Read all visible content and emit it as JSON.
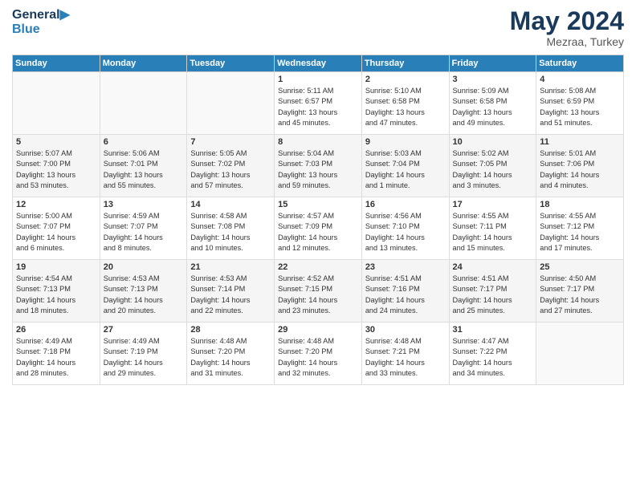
{
  "logo": {
    "line1": "General",
    "line2": "Blue"
  },
  "title": "May 2024",
  "location": "Mezraa, Turkey",
  "weekdays": [
    "Sunday",
    "Monday",
    "Tuesday",
    "Wednesday",
    "Thursday",
    "Friday",
    "Saturday"
  ],
  "weeks": [
    [
      {
        "day": "",
        "info": ""
      },
      {
        "day": "",
        "info": ""
      },
      {
        "day": "",
        "info": ""
      },
      {
        "day": "1",
        "info": "Sunrise: 5:11 AM\nSunset: 6:57 PM\nDaylight: 13 hours\nand 45 minutes."
      },
      {
        "day": "2",
        "info": "Sunrise: 5:10 AM\nSunset: 6:58 PM\nDaylight: 13 hours\nand 47 minutes."
      },
      {
        "day": "3",
        "info": "Sunrise: 5:09 AM\nSunset: 6:58 PM\nDaylight: 13 hours\nand 49 minutes."
      },
      {
        "day": "4",
        "info": "Sunrise: 5:08 AM\nSunset: 6:59 PM\nDaylight: 13 hours\nand 51 minutes."
      }
    ],
    [
      {
        "day": "5",
        "info": "Sunrise: 5:07 AM\nSunset: 7:00 PM\nDaylight: 13 hours\nand 53 minutes."
      },
      {
        "day": "6",
        "info": "Sunrise: 5:06 AM\nSunset: 7:01 PM\nDaylight: 13 hours\nand 55 minutes."
      },
      {
        "day": "7",
        "info": "Sunrise: 5:05 AM\nSunset: 7:02 PM\nDaylight: 13 hours\nand 57 minutes."
      },
      {
        "day": "8",
        "info": "Sunrise: 5:04 AM\nSunset: 7:03 PM\nDaylight: 13 hours\nand 59 minutes."
      },
      {
        "day": "9",
        "info": "Sunrise: 5:03 AM\nSunset: 7:04 PM\nDaylight: 14 hours\nand 1 minute."
      },
      {
        "day": "10",
        "info": "Sunrise: 5:02 AM\nSunset: 7:05 PM\nDaylight: 14 hours\nand 3 minutes."
      },
      {
        "day": "11",
        "info": "Sunrise: 5:01 AM\nSunset: 7:06 PM\nDaylight: 14 hours\nand 4 minutes."
      }
    ],
    [
      {
        "day": "12",
        "info": "Sunrise: 5:00 AM\nSunset: 7:07 PM\nDaylight: 14 hours\nand 6 minutes."
      },
      {
        "day": "13",
        "info": "Sunrise: 4:59 AM\nSunset: 7:07 PM\nDaylight: 14 hours\nand 8 minutes."
      },
      {
        "day": "14",
        "info": "Sunrise: 4:58 AM\nSunset: 7:08 PM\nDaylight: 14 hours\nand 10 minutes."
      },
      {
        "day": "15",
        "info": "Sunrise: 4:57 AM\nSunset: 7:09 PM\nDaylight: 14 hours\nand 12 minutes."
      },
      {
        "day": "16",
        "info": "Sunrise: 4:56 AM\nSunset: 7:10 PM\nDaylight: 14 hours\nand 13 minutes."
      },
      {
        "day": "17",
        "info": "Sunrise: 4:55 AM\nSunset: 7:11 PM\nDaylight: 14 hours\nand 15 minutes."
      },
      {
        "day": "18",
        "info": "Sunrise: 4:55 AM\nSunset: 7:12 PM\nDaylight: 14 hours\nand 17 minutes."
      }
    ],
    [
      {
        "day": "19",
        "info": "Sunrise: 4:54 AM\nSunset: 7:13 PM\nDaylight: 14 hours\nand 18 minutes."
      },
      {
        "day": "20",
        "info": "Sunrise: 4:53 AM\nSunset: 7:13 PM\nDaylight: 14 hours\nand 20 minutes."
      },
      {
        "day": "21",
        "info": "Sunrise: 4:53 AM\nSunset: 7:14 PM\nDaylight: 14 hours\nand 22 minutes."
      },
      {
        "day": "22",
        "info": "Sunrise: 4:52 AM\nSunset: 7:15 PM\nDaylight: 14 hours\nand 23 minutes."
      },
      {
        "day": "23",
        "info": "Sunrise: 4:51 AM\nSunset: 7:16 PM\nDaylight: 14 hours\nand 24 minutes."
      },
      {
        "day": "24",
        "info": "Sunrise: 4:51 AM\nSunset: 7:17 PM\nDaylight: 14 hours\nand 25 minutes."
      },
      {
        "day": "25",
        "info": "Sunrise: 4:50 AM\nSunset: 7:17 PM\nDaylight: 14 hours\nand 27 minutes."
      }
    ],
    [
      {
        "day": "26",
        "info": "Sunrise: 4:49 AM\nSunset: 7:18 PM\nDaylight: 14 hours\nand 28 minutes."
      },
      {
        "day": "27",
        "info": "Sunrise: 4:49 AM\nSunset: 7:19 PM\nDaylight: 14 hours\nand 29 minutes."
      },
      {
        "day": "28",
        "info": "Sunrise: 4:48 AM\nSunset: 7:20 PM\nDaylight: 14 hours\nand 31 minutes."
      },
      {
        "day": "29",
        "info": "Sunrise: 4:48 AM\nSunset: 7:20 PM\nDaylight: 14 hours\nand 32 minutes."
      },
      {
        "day": "30",
        "info": "Sunrise: 4:48 AM\nSunset: 7:21 PM\nDaylight: 14 hours\nand 33 minutes."
      },
      {
        "day": "31",
        "info": "Sunrise: 4:47 AM\nSunset: 7:22 PM\nDaylight: 14 hours\nand 34 minutes."
      },
      {
        "day": "",
        "info": ""
      }
    ]
  ]
}
